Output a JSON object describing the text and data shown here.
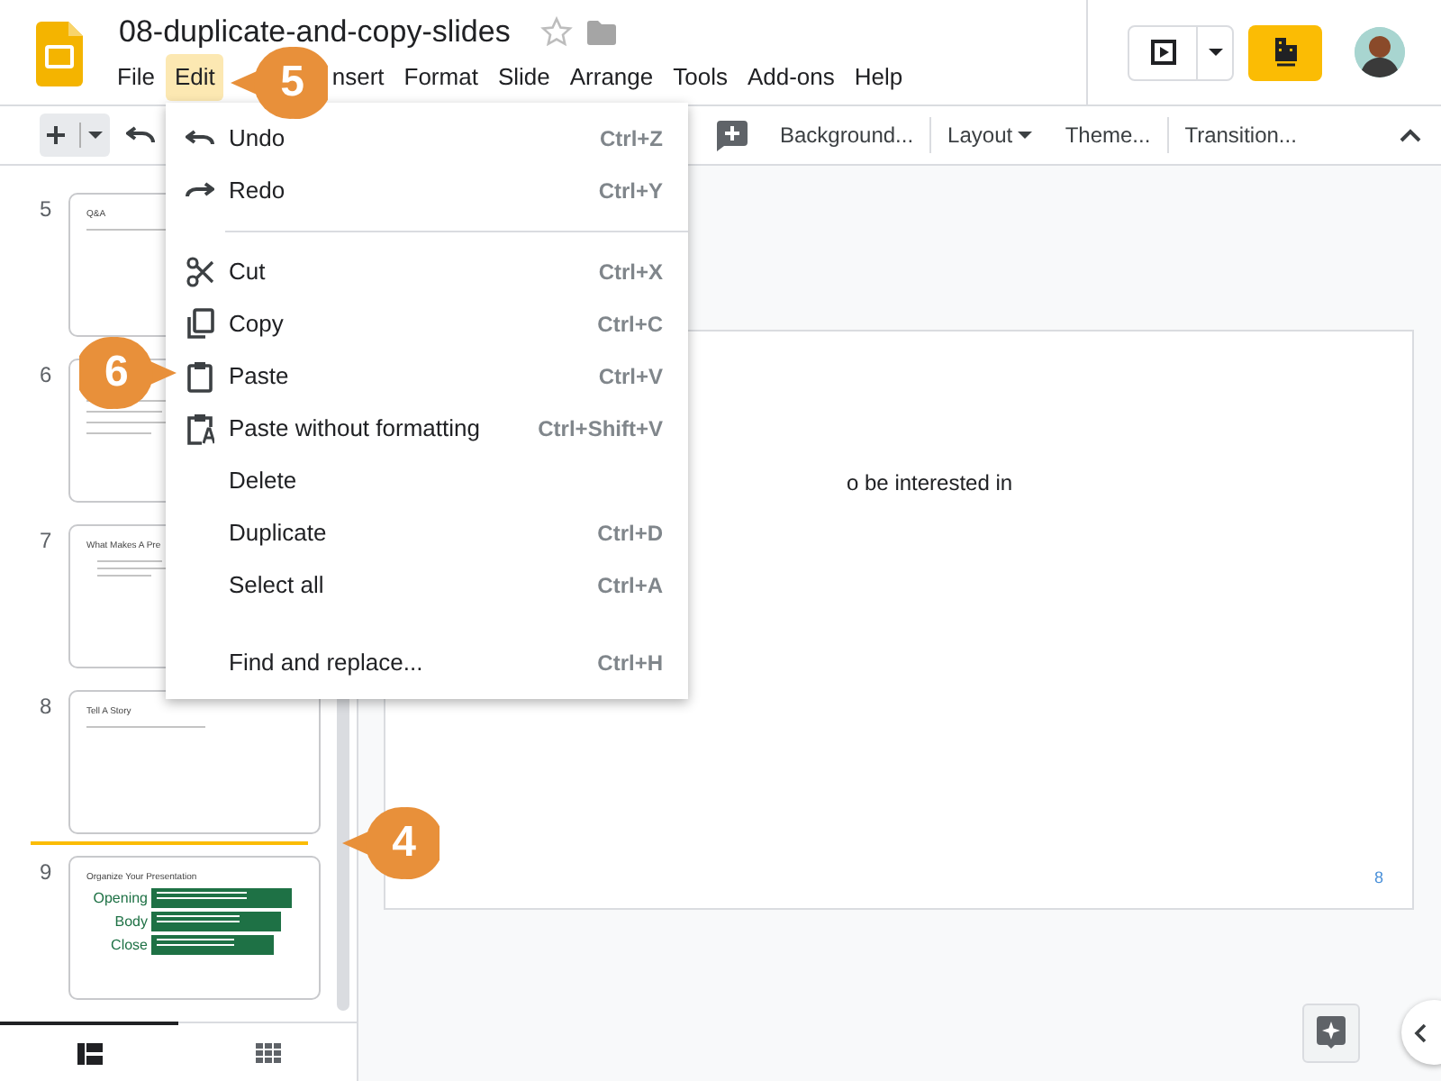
{
  "document": {
    "title": "08-duplicate-and-copy-slides",
    "starred": false
  },
  "menu_bar": [
    {
      "label": "File",
      "selected": false
    },
    {
      "label": "Edit",
      "selected": true
    },
    {
      "label": "nsert",
      "selected": false,
      "kind": "partial"
    },
    {
      "label": "Format",
      "selected": false
    },
    {
      "label": "Slide",
      "selected": false
    },
    {
      "label": "Arrange",
      "selected": false
    },
    {
      "label": "Tools",
      "selected": false
    },
    {
      "label": "Add-ons",
      "selected": false
    },
    {
      "label": "Help",
      "selected": false
    }
  ],
  "toolbar": [
    {
      "label": "Background...",
      "kind": "button"
    },
    {
      "label": "Layout",
      "kind": "dropdown"
    },
    {
      "label": "Theme...",
      "kind": "button"
    },
    {
      "label": "Transition...",
      "kind": "button"
    }
  ],
  "edit_menu": [
    {
      "kind": "item",
      "label": "Undo",
      "shortcut": "Ctrl+Z"
    },
    {
      "kind": "item",
      "label": "Redo",
      "shortcut": "Ctrl+Y"
    },
    {
      "kind": "divider"
    },
    {
      "kind": "item",
      "label": "Cut",
      "shortcut": "Ctrl+X"
    },
    {
      "kind": "item",
      "label": "Copy",
      "shortcut": "Ctrl+C"
    },
    {
      "kind": "item",
      "label": "Paste",
      "shortcut": "Ctrl+V"
    },
    {
      "kind": "item",
      "label": "Paste without formatting",
      "shortcut": "Ctrl+Shift+V"
    },
    {
      "kind": "item",
      "label": "Delete"
    },
    {
      "kind": "item",
      "label": "Duplicate",
      "shortcut": "Ctrl+D"
    },
    {
      "kind": "item",
      "label": "Select all",
      "shortcut": "Ctrl+A"
    },
    {
      "kind": "spacer"
    },
    {
      "kind": "item",
      "label": "Find and replace...",
      "shortcut": "Ctrl+H"
    }
  ],
  "slides": [
    {
      "number": "5",
      "kind": "text",
      "title": "Q&A",
      "drop_line_below": false
    },
    {
      "number": "6",
      "kind": "lines",
      "drop_line_below": false
    },
    {
      "number": "7",
      "kind": "bullets",
      "title": "What Makes A Pre",
      "drop_line_below": false
    },
    {
      "number": "8",
      "kind": "text",
      "title": "Tell A Story",
      "drop_line_below": true
    },
    {
      "number": "9",
      "kind": "sections",
      "title": "Organize Your Presentation",
      "rows": [
        "Opening",
        "Body",
        "Close"
      ],
      "drop_line_below": false
    }
  ],
  "filmstrip_view": [
    {
      "kind": "list",
      "selected": true
    },
    {
      "kind": "grid",
      "selected": false
    }
  ],
  "canvas": {
    "text": "o be interested in",
    "page_number": "8"
  },
  "callouts": [
    {
      "number": "5"
    },
    {
      "number": "6"
    },
    {
      "number": "4"
    }
  ]
}
